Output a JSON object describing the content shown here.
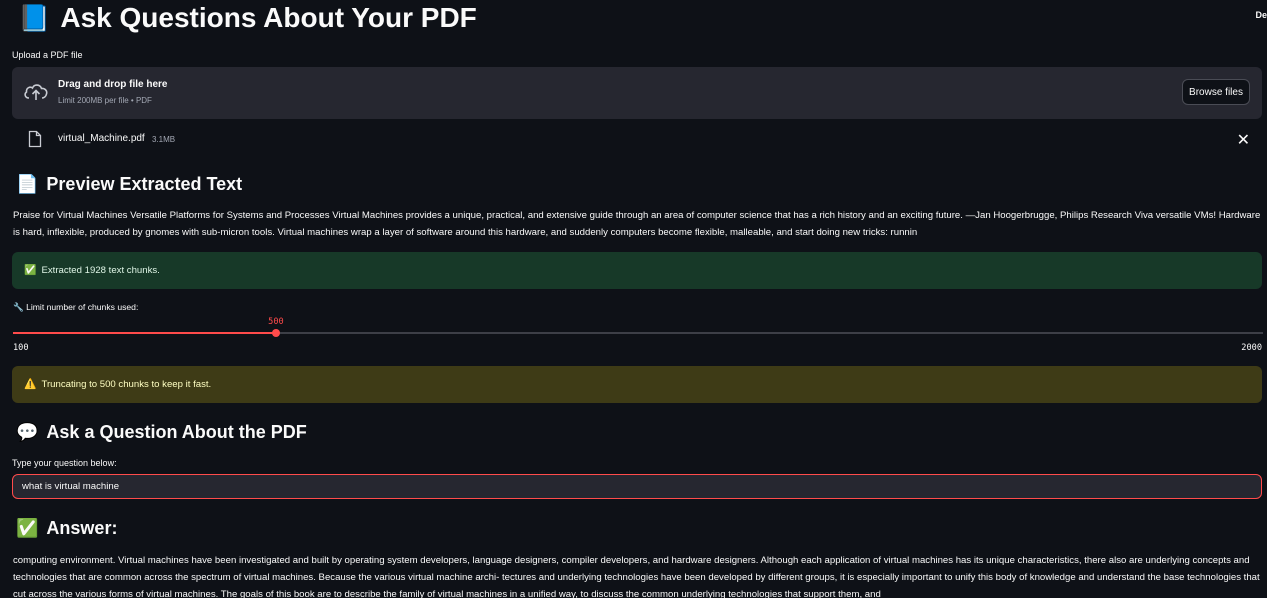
{
  "header": {
    "title_icon": "📘",
    "title": "Ask Questions About Your PDF",
    "deploy_label": "De"
  },
  "uploader": {
    "label": "Upload a PDF file",
    "drop_title": "Drag and drop file here",
    "drop_sub": "Limit 200MB per file • PDF",
    "browse_label": "Browse files",
    "file_name": "virtual_Machine.pdf",
    "file_size": "3.1MB"
  },
  "preview": {
    "icon": "📄",
    "heading": "Preview Extracted Text",
    "text": "Praise for Virtual Machines Versatile Platforms for Systems and Processes Virtual Machines provides a unique, practical, and extensive guide through an area of computer science that has a rich history and an exciting future. —Jan Hoogerbrugge, Philips Research Viva versatile VMs! Hardware is hard, inflexible, produced by gnomes with sub-micron tools. Virtual machines wrap a layer of software around this hardware, and suddenly computers become flexible, malleable, and start doing new tricks: runnin"
  },
  "success_alert": {
    "icon": "✅",
    "text": "Extracted 1928 text chunks."
  },
  "slider": {
    "label": "🔧 Limit number of chunks used:",
    "value": 500,
    "value_text": "500",
    "min": 100,
    "max": 2000,
    "min_text": "100",
    "max_text": "2000",
    "accent": "#ff4b4b"
  },
  "warning_alert": {
    "icon": "⚠️",
    "text": "Truncating to 500 chunks to keep it fast."
  },
  "question": {
    "icon": "💬",
    "heading": "Ask a Question About the PDF",
    "input_label": "Type your question below:",
    "input_value": "what is virtual machine"
  },
  "answer": {
    "icon": "✅",
    "heading": "Answer:",
    "text": "computing environment. Virtual machines have been investigated and built by operating system developers, language designers, compiler developers, and hardware designers. Although each application of virtual machines has its unique characteristics, there also are underlying concepts and technologies that are common across the spectrum of virtual machines. Because the various virtual machine archi- tectures and underlying technologies have been developed by different groups, it is especially important to unify this body of knowledge and understand the base technologies that cut across the various forms of virtual machines. The goals of this book are to describe the family of virtual machines in a unified way, to discuss the common underlying technologies that support them, and"
  }
}
